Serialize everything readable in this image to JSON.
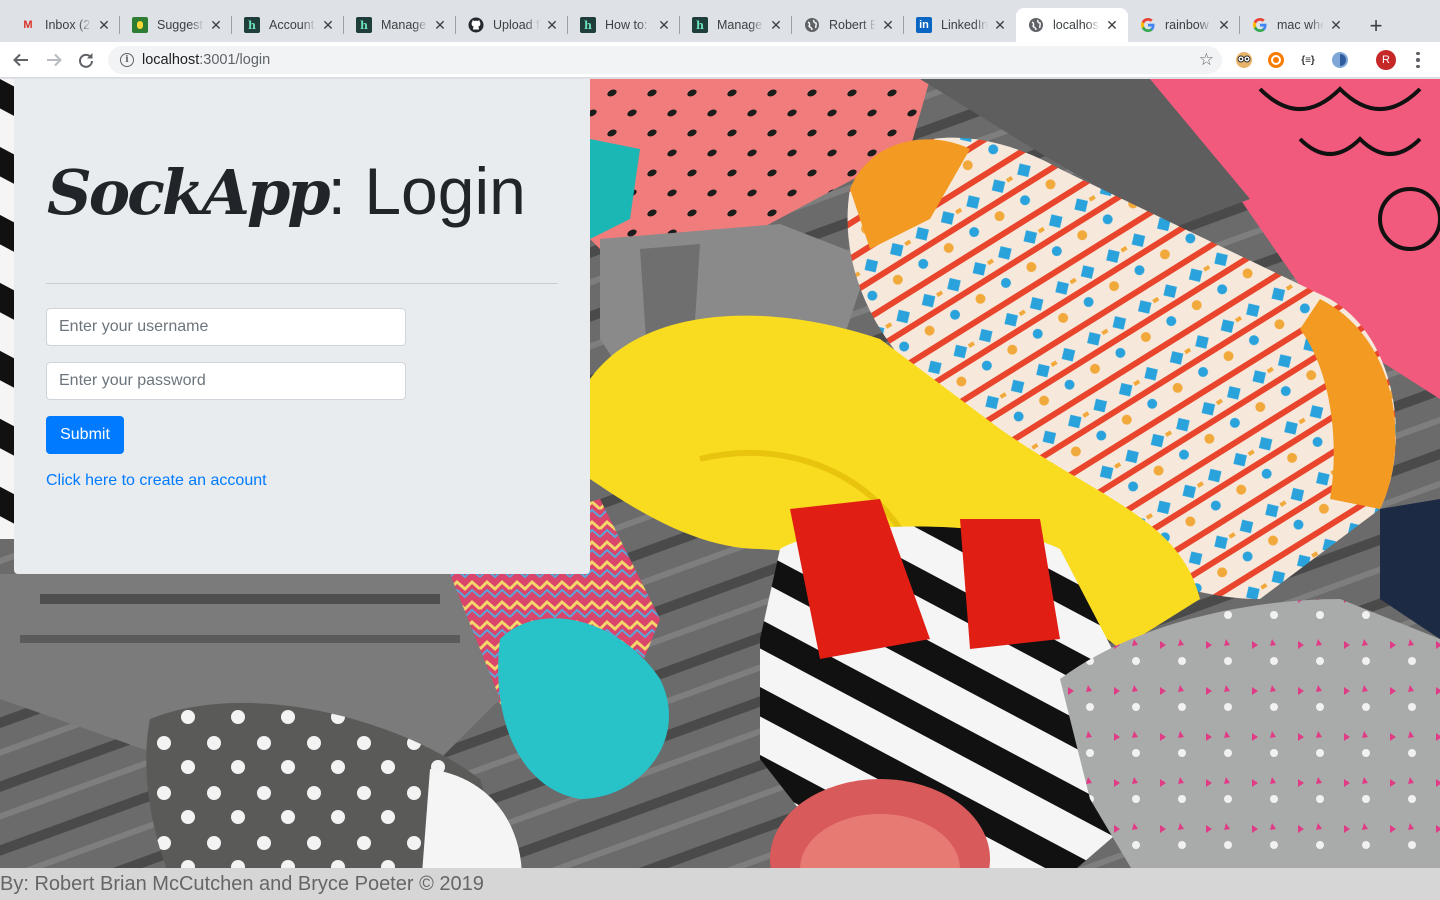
{
  "browser": {
    "tabs": [
      {
        "title": "Inbox (2,",
        "icon": "gmail-icon"
      },
      {
        "title": "Suggest",
        "icon": "extension-icon"
      },
      {
        "title": "Account",
        "icon": "h-site-icon"
      },
      {
        "title": "Manage",
        "icon": "h-site-icon"
      },
      {
        "title": "Upload f",
        "icon": "github-icon"
      },
      {
        "title": "How to:",
        "icon": "h-site-icon"
      },
      {
        "title": "Manage",
        "icon": "h-site-icon"
      },
      {
        "title": "Robert B",
        "icon": "globe-icon"
      },
      {
        "title": "LinkedIn",
        "icon": "linkedin-icon"
      },
      {
        "title": "localhos",
        "icon": "globe-icon",
        "active": true
      },
      {
        "title": "rainbow",
        "icon": "google-icon"
      },
      {
        "title": "mac whe",
        "icon": "google-icon"
      }
    ],
    "url_host": "localhost",
    "url_rest": ":3001/login",
    "profile_initial": "R"
  },
  "login": {
    "brand": "SockApp",
    "title_rest": ": Login",
    "username_placeholder": "Enter your username",
    "password_placeholder": "Enter your password",
    "submit_label": "Submit",
    "create_account_link": "Click here to create an account"
  },
  "footer": {
    "credit": "By: Robert Brian McCutchen and Bryce Poeter © 2019"
  },
  "colors": {
    "primary": "#007bff",
    "card_bg": "#e9ecef",
    "text": "#212529"
  }
}
